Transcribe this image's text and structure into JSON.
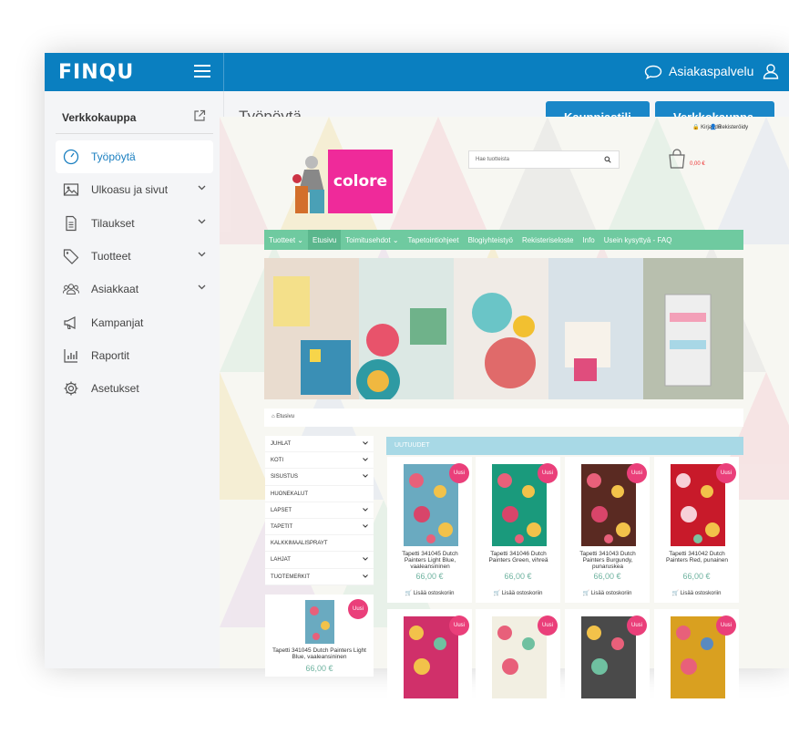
{
  "admin": {
    "logo": "FINQU",
    "customer_service": "Asiakaspalvelu",
    "shop_label": "Verkkokauppa",
    "page_title": "Työpöytä",
    "btn_left": "Kauppiastili",
    "btn_right": "Verkkokauppa",
    "nav": [
      {
        "label": "Työpöytä",
        "icon": "dashboard-icon"
      },
      {
        "label": "Ulkoasu ja sivut",
        "icon": "image-icon"
      },
      {
        "label": "Tilaukset",
        "icon": "document-icon"
      },
      {
        "label": "Tuotteet",
        "icon": "tag-icon"
      },
      {
        "label": "Asiakkaat",
        "icon": "users-icon"
      },
      {
        "label": "Kampanjat",
        "icon": "megaphone-icon"
      },
      {
        "label": "Raportit",
        "icon": "bar-chart-icon"
      },
      {
        "label": "Asetukset",
        "icon": "gear-icon"
      }
    ],
    "accent": "#0a7fc0"
  },
  "store": {
    "top_links": {
      "login": "Kirjaudu",
      "register": "Rekisteröidy"
    },
    "logo_text": "colore",
    "search_placeholder": "Hae tuotteista",
    "cart_total": "0,00 €",
    "menu": [
      "Tuotteet",
      "Etusivu",
      "Toimitusehdot",
      "Tapetointiohjeet",
      "Blogiyhteistyö",
      "Rekisteriseloste",
      "Info",
      "Usein kysyttyä - FAQ"
    ],
    "breadcrumb": "Etusivu",
    "categories": [
      "JUHLAT",
      "KOTI",
      "SISUSTUS",
      "HUONEKALUT",
      "LAPSET",
      "TAPETIT",
      "KALKKIMAALISPRAYT",
      "LAHJAT",
      "TUOTEMERKIT"
    ],
    "new_header": "UUTUUDET",
    "badge": "Uusi",
    "add_to_cart": "Lisää ostoskoriin",
    "products": [
      {
        "name": "Tapetti 341045 Dutch Painters Light Blue, vaaleansininen",
        "price": "66,00 €",
        "bg": "#6aaac0"
      },
      {
        "name": "Tapetti 341046 Dutch Painters Green, vihreä",
        "price": "66,00 €",
        "bg": "#1a9a7c"
      },
      {
        "name": "Tapetti 341043 Dutch Painters Burgundy, punaruskea",
        "price": "66,00 €",
        "bg": "#5a2a22"
      },
      {
        "name": "Tapetti 341042 Dutch Painters Red, punainen",
        "price": "66,00 €",
        "bg": "#c81a2a"
      }
    ],
    "row2_bgs": [
      "#d0306a",
      "#f2efe2",
      "#4a4a4a",
      "#d9a020"
    ],
    "side_product": {
      "name": "Tapetti 341045 Dutch Painters Light Blue, vaaleansininen",
      "price": "66,00 €"
    }
  }
}
